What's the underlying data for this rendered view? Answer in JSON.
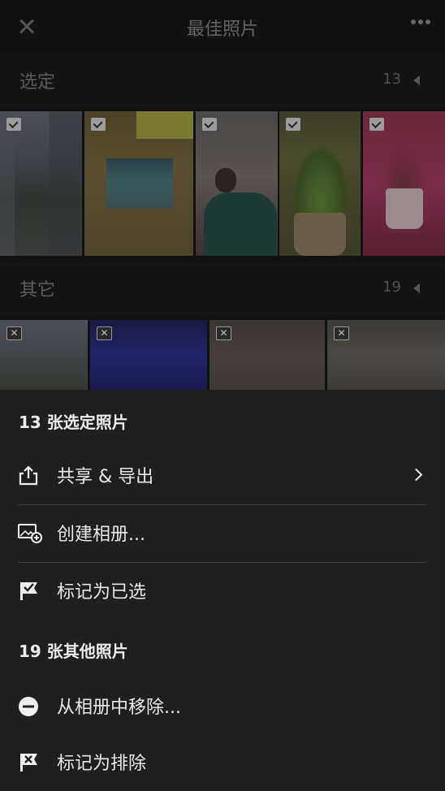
{
  "header": {
    "title": "最佳照片"
  },
  "sections": {
    "selected": {
      "label": "选定",
      "count": "13"
    },
    "others": {
      "label": "其它",
      "count": "19"
    }
  },
  "sheet": {
    "selected_heading": "13 张选定照片",
    "others_heading": "19 张其他照片",
    "items": {
      "share_export": "共享 & 导出",
      "create_album": "创建相册...",
      "mark_selected": "标记为已选",
      "remove_from_album": "从相册中移除...",
      "mark_excluded": "标记为排除"
    }
  },
  "icons": [
    "close-icon",
    "more-icon",
    "collapse-arrow-icon",
    "checkbox-checked-icon",
    "checkbox-x-icon",
    "share-icon",
    "chevron-right-icon",
    "create-album-icon",
    "flag-check-icon",
    "remove-circle-icon",
    "flag-x-icon"
  ]
}
